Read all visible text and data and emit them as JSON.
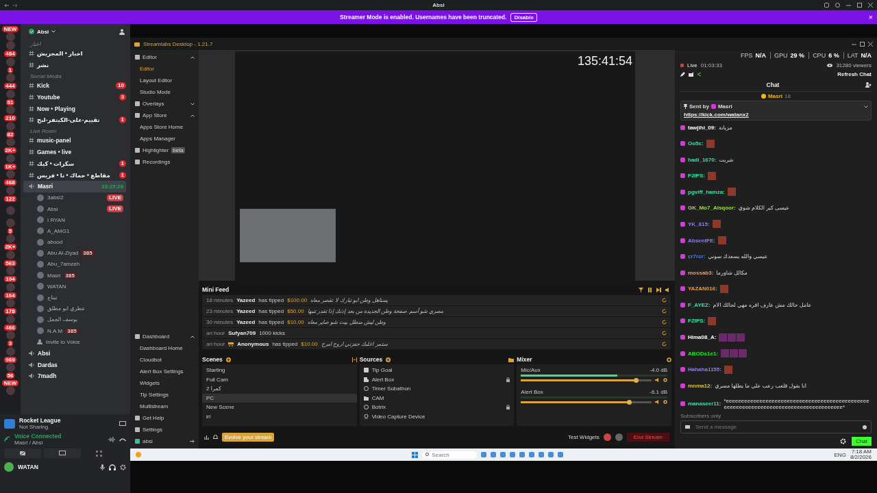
{
  "window": {
    "title": "Absi"
  },
  "banner": {
    "text": "Streamer Mode is enabled. Usernames have been truncated.",
    "button": "Disable",
    "close": "×"
  },
  "servers": [
    {
      "kind": "new",
      "badge": "NEW"
    },
    {
      "kind": "count",
      "badge": "484"
    },
    {
      "kind": "count",
      "badge": "1"
    },
    {
      "kind": "count",
      "badge": "444"
    },
    {
      "kind": "count",
      "badge": "51"
    },
    {
      "kind": "count",
      "badge": "210"
    },
    {
      "kind": "count",
      "badge": "82"
    },
    {
      "kind": "count",
      "badge": "2K+"
    },
    {
      "kind": "count",
      "badge": "1K+"
    },
    {
      "kind": "count",
      "badge": "468"
    },
    {
      "kind": "count",
      "badge": "122"
    },
    {
      "kind": "plain"
    },
    {
      "kind": "count",
      "badge": "5"
    },
    {
      "kind": "count",
      "badge": "2K+"
    },
    {
      "kind": "count",
      "badge": "563"
    },
    {
      "kind": "count",
      "badge": "104"
    },
    {
      "kind": "count",
      "badge": "164"
    },
    {
      "kind": "count",
      "badge": "178"
    },
    {
      "kind": "count",
      "badge": "466"
    },
    {
      "kind": "count",
      "badge": "3"
    },
    {
      "kind": "count",
      "badge": "969"
    },
    {
      "kind": "count",
      "badge": "56"
    },
    {
      "kind": "new",
      "badge": "NEW"
    }
  ],
  "server": {
    "name": "Absi",
    "channels": [
      {
        "kind": "category",
        "label": "اخبار"
      },
      {
        "kind": "text",
        "label": "اخبار • المجريش"
      },
      {
        "kind": "text",
        "label": "نشر"
      },
      {
        "kind": "category",
        "label": "Social Media"
      },
      {
        "kind": "text",
        "label": "Kick",
        "badge": "10"
      },
      {
        "kind": "text",
        "label": "Youtube",
        "badge": "3"
      },
      {
        "kind": "text",
        "label": "Now • Playing"
      },
      {
        "kind": "text",
        "label": "تقييم-على-الكيتفر-لبح",
        "badge": "1"
      },
      {
        "kind": "category",
        "label": "Live Room"
      },
      {
        "kind": "text",
        "label": "music-panel"
      },
      {
        "kind": "text",
        "label": "Games • live"
      },
      {
        "kind": "text",
        "label": "سكرات • كيك",
        "badge": "1"
      },
      {
        "kind": "text",
        "label": "مقاطع • حماك • تا • فريس",
        "badge": "1"
      },
      {
        "kind": "voice",
        "label": "Masri",
        "timer": "33:25:29",
        "selected": true,
        "children": [
          {
            "name": "3absl2",
            "live": "LIVE"
          },
          {
            "name": "Absi",
            "live": "LIVE"
          },
          {
            "name": "I RYAN"
          },
          {
            "name": "A_AMG1"
          },
          {
            "name": "abood"
          },
          {
            "name": "Abu Al-Ziyad",
            "tag": "385"
          },
          {
            "name": "Abu_7amzeh"
          },
          {
            "name": "Masri",
            "tag": "385"
          },
          {
            "name": "WATAN"
          },
          {
            "name": "تيناج"
          },
          {
            "name": "عطري ابو مطلق"
          },
          {
            "name": "يوسف الجمل"
          },
          {
            "name": "N.A.M",
            "tag": "385"
          }
        ]
      },
      {
        "kind": "invite",
        "label": "Invite to Voice"
      },
      {
        "kind": "voice",
        "label": "Absi",
        "selected": false
      },
      {
        "kind": "voice",
        "label": "Dardas",
        "selected": false
      },
      {
        "kind": "voice",
        "label": "7madh",
        "selected": false
      }
    ]
  },
  "panel": {
    "activity": {
      "title": "Rocket League",
      "subtitle": "Not Sharing"
    },
    "voice": {
      "status": "Voice Connected",
      "channel": "Masri / Absi"
    },
    "user": {
      "name": "WATAN"
    }
  },
  "streamlabs": {
    "title": "Streamlabs Desktop - 1.21.7",
    "nav": [
      {
        "label": "Editor",
        "selected": false,
        "expanded": true,
        "children": [
          {
            "label": "Editor",
            "selected": true
          },
          {
            "label": "Layout Editor",
            "selected": false
          },
          {
            "label": "Studio Mode",
            "selected": false
          }
        ]
      },
      {
        "label": "Overlays",
        "selected": false,
        "expanded": false
      },
      {
        "label": "App Store",
        "selected": false,
        "expanded": true,
        "children": [
          {
            "label": "Apps Store Home",
            "selected": false
          },
          {
            "label": "Apps Manager",
            "selected": false
          }
        ]
      },
      {
        "label": "Highlighter",
        "selected": false,
        "badge": "beta"
      },
      {
        "label": "Recordings",
        "selected": false
      }
    ],
    "nav_bottom": [
      {
        "label": "Dashboard",
        "selected": false,
        "expanded": true,
        "children": [
          {
            "label": "Dashboard Home",
            "selected": false
          },
          {
            "label": "Cloudbot",
            "selected": false
          },
          {
            "label": "Alert Box Settings",
            "selected": false
          },
          {
            "label": "Widgets",
            "selected": false
          },
          {
            "label": "Tip Settings",
            "selected": false
          },
          {
            "label": "Multistream",
            "selected": false
          }
        ]
      },
      {
        "label": "Get Help",
        "selected": false
      },
      {
        "label": "Settings",
        "selected": false
      }
    ],
    "account": "absi",
    "preview": {
      "timer": "135:41:54"
    },
    "mini_feed": {
      "title": "Mini Feed",
      "events": [
        {
          "time": "18 minutes",
          "name": "Yazeed",
          "action": "has tipped",
          "amount": "$100.00",
          "message": "يستاهل وطن ابو تبارك لا تقصر معاه"
        },
        {
          "time": "23 minutes",
          "name": "Yazeed",
          "action": "has tipped",
          "amount": "$50.00",
          "message": "مصري شو أسم صفحة وطن الجديدة من بعد إذنك إذا تقدر تنبها"
        },
        {
          "time": "30 minutes",
          "name": "Yazeed",
          "action": "has tipped",
          "amount": "$10.00",
          "message": "وطن ليش منطل بيت شو صاير معاه"
        },
        {
          "time": "an hour",
          "name": "Sufyan709",
          "action": "1000 kicks"
        },
        {
          "time": "an hour",
          "name": "Anonymous",
          "anonymous": true,
          "action": "has tipped",
          "amount": "$10.00",
          "message": "ستمر اغلبك حفزني اروح امرح"
        }
      ]
    },
    "scenes": {
      "title": "Scenes",
      "items": [
        {
          "label": "Starting",
          "selected": false
        },
        {
          "label": "Full Cam",
          "selected": false
        },
        {
          "label": "كمرا 2",
          "selected": false
        },
        {
          "label": "PC",
          "selected": true
        },
        {
          "label": "New Scene",
          "selected": false
        },
        {
          "label": "irl",
          "selected": false
        }
      ]
    },
    "sources": {
      "title": "Sources",
      "items": [
        {
          "label": "Tip Goal",
          "kind": "goal",
          "locked": false
        },
        {
          "label": "Alert Box",
          "kind": "alert",
          "locked": true
        },
        {
          "label": "Timer Subathon",
          "kind": "browser",
          "locked": false
        },
        {
          "label": "CAM",
          "kind": "folder",
          "locked": false
        },
        {
          "label": "Botrix",
          "kind": "browser",
          "locked": true
        },
        {
          "label": "Video Capture Device",
          "kind": "camera",
          "locked": false
        }
      ]
    },
    "mixer": {
      "title": "Mixer",
      "channels": [
        {
          "name": "Mic/Aux",
          "reading": "-4.0 dB",
          "level": 0.88,
          "active": true
        },
        {
          "name": "Alert Box",
          "reading": "-6.1 dB",
          "level": 0.83,
          "active": false
        }
      ]
    },
    "footer": {
      "promo": "Evolve your stream",
      "test_widgets": "Test Widgets",
      "end_stream": "End Stream"
    }
  },
  "chat": {
    "stats": [
      {
        "label": "FPS",
        "value": "N/A"
      },
      {
        "label": "GPU",
        "value": "29 %"
      },
      {
        "label": "CPU",
        "value": "6 %"
      },
      {
        "label": "LAT",
        "value": "N/A"
      }
    ],
    "live": "Live",
    "uptime": "01:03:33",
    "viewers": "31280 viewers",
    "refresh": "Refresh Chat",
    "title": "Chat",
    "gift": {
      "name": "Masri",
      "count": "18"
    },
    "pinned": {
      "label": "Sent by",
      "author": "Masri",
      "link": "https://kick.com/watanx2"
    },
    "messages": [
      {
        "name": "tawjihi_09:",
        "color": "#ffffff",
        "kind": "text",
        "text": "مزيانة"
      },
      {
        "name": "Oo5c:",
        "color": "#2ee6a8",
        "kind": "emote"
      },
      {
        "name": "hadi_1670:",
        "color": "#2ee6a8",
        "kind": "text",
        "text": "شربت"
      },
      {
        "name": "F2IPS:",
        "color": "#2ee6a8",
        "kind": "emote"
      },
      {
        "name": "pgviff_hamza:",
        "color": "#2ee6a8",
        "kind": "emote"
      },
      {
        "name": "GK_Mo7_Alsqoor:",
        "color": "#9be22a",
        "kind": "text",
        "text": "عيسى كبر الكلام شوي"
      },
      {
        "name": "YK_815:",
        "color": "#8a7cff",
        "kind": "emote"
      },
      {
        "name": "AbsentFE:",
        "color": "#8a7cff",
        "kind": "emote"
      },
      {
        "name": "cr7rcr:",
        "color": "#4a7dff",
        "kind": "text",
        "text": "عيسي والله يسعدك سوني"
      },
      {
        "name": "mossab3:",
        "color": "#e0a070",
        "kind": "text",
        "text": "مكالل شاورما"
      },
      {
        "name": "YAZAN016:",
        "color": "#ff9a1a",
        "kind": "emote"
      },
      {
        "name": "F_AYEZ:",
        "color": "#2ee6a8",
        "kind": "text",
        "text": "عامل حالك مش عارف اقره مهي لحالك الام"
      },
      {
        "name": "FZIPS:",
        "color": "#2ee6a8",
        "kind": "emote"
      },
      {
        "name": "Hima08_A:",
        "color": "#ffffff",
        "kind": "emotes"
      },
      {
        "name": "ABODs1e1:",
        "color": "#22e622",
        "kind": "emotes"
      },
      {
        "name": "Hahaha1155:",
        "color": "#8a7cff",
        "kind": "emote"
      },
      {
        "name": "mnma12:",
        "color": "#e6c02a",
        "kind": "text",
        "text": "انا بقول قلعب رعب علي ما يطلها مسري"
      },
      {
        "name": "manaseer11:",
        "color": "#2ee6a8",
        "kind": "text",
        "text": "*eeeeeeeeeeeeeeeeeeeeeeeeeeeeeeeeeeeeeeeeeeeeeeeeeeeeeeeeeeeeeeeeeeeeeeeeeeeeeeeeeeeeee*"
      }
    ],
    "subscribers_only": "Subscribers only",
    "placeholder": "Send a message",
    "send": "Chat"
  },
  "taskbar": {
    "placeholder": "Search",
    "language": "ENG",
    "time": "7:18 AM",
    "date": "8/2/2026"
  }
}
